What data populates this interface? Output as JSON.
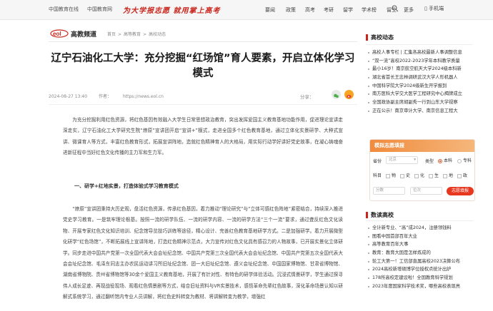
{
  "topbar": {
    "links": [
      "中国教育在线",
      "中国教育网"
    ],
    "slogan": "为大学报志愿 就用掌上高考",
    "nav": [
      "要闻",
      "政策",
      "高考",
      "考研",
      "留学",
      "学术榜",
      "留生",
      "更多"
    ],
    "phone_label": "手机端"
  },
  "logo": {
    "text": "高教频道"
  },
  "breadcrumb": [
    "首页",
    ">",
    "高等教育",
    ">",
    "高校动态"
  ],
  "article": {
    "title": "辽宁石油化工大学：充分挖掘“红场馆”育人要素，开启立体化学习模式",
    "date": "2024-08-27 13:40",
    "source": "作者：",
    "url": "https://news.eol.cn",
    "share_label": "分享：",
    "paragraphs": [
      "为充分挖掘利用红色资源，将红色基因有效融入大学生日常思想政治教育，突出发挥爱国主义教育基地功能作用，促进理论宣讲走深走实，辽宁石油化工大学研究生院“燎原”宣讲团开启“宣讲+”模式，走进全国多个红色教育基地，通过立体化实景研学、大种式宣讲、微课育人等方式，丰富红色教育形式，拓展宣讲阵地，造就红色精神育人的大格局，用实际行动学好讲好党史故事，在凝心铸魂奋进新征程中当好红色文化传播的主力军和生力军。",
      "“燎原”宣讲团秉持大历史观，盘活红色资源，传承红色基因，着力推动“理论研究”与“立体可感红色阵地”紧密结合，持续深入推进党史学习教育。一是筑牢理论根基。按照一流的研学队伍、一流的研学内容、一流的研学方法“三个一流”要求，通过聋反红色文化读物、开展专家红色文化知识培训、纪念馆导览技巧训练等途径，精心设计、完善红色教育基地研学方式。二是加强研学。着力开展微型化研学“红色场馆”，不断拓展线上宣讲阵地，打造红色精神示范点，大力宣传对红色文化具有感召力的人物故事，已开展实景化立体研学。同步走进中国共产党第一次全国代表大会会址纪念馆、中国共产党第三次全国代表大会会址纪念馆、中国共产党第五次全国代表大会会址纪念馆、毛泽东同志主办农民运动讲习所旧址纪念馆、团一大旧址纪念馆、遵义会址纪念馆、中国国家博物馆、甘肃省博物馆、湖南省博物院、贵州省博物馆等30余个爱国主义教育基地，开展了有针对性、有特色的研学体验活动。沉浸式情景研学，学生通过探寻伟人成长足迹、再现战役现场、观看红色情景剧等方式，结合旧址资料与VR实景技术，感悟革命先辈红色故事，深化革命场景认知以研解式系统学习，通过翻听馆内专业人员讲解，将红色史料转变为教材、将讲解转变为教学，增强红"
    ],
    "section_heading": "一、研学+红地实景，打造体验式学习教育模式"
  },
  "sidebar": {
    "news_title": "高校动态",
    "news": [
      "高校人事专栏 | 汇集各高校最新人事调整信息",
      "“双一流”高校2022-2023学年本科教学质量",
      "最小16岁！南京航空航天大学2024级本科新",
      "湖北省首长王忠林调研武汉大学人形机器人",
      "中国科学院大学2024级新生开学报到",
      "南方医科大学交大医学工程研究中心揭牌成立",
      "全国政协副主席胡副秀一行到山东大学视察",
      "正在公示！南京审计大学、南京信息工程大"
    ],
    "volunteer": {
      "title": "模拟志愿填报",
      "province_label": "省份",
      "province_value": "北京",
      "type_label": "类型",
      "type_options": [
        "本科",
        "专科"
      ],
      "subject_label": "科目",
      "subjects": [
        "物",
        "史",
        "化",
        "生",
        "地",
        "政"
      ],
      "score_placeholder": "分数",
      "rank_placeholder": "位次",
      "button": "志愿填报"
    },
    "hot_title": "数读高校",
    "hot": [
      "全计新专业、“高”成2024，注册领钱料",
      "图看中国首部百年大业",
      "高等教育百年大事",
      "教育：教育大国是怎样炼成的",
      "轮工大第一！工信部直属高校2023决算公布",
      "2024高校新增硕博学位授权点统计出炉",
      "178所高校定建设啦！全国教育科学规划",
      "2023年度国家科学技术奖，哪些高校表现亮"
    ]
  }
}
